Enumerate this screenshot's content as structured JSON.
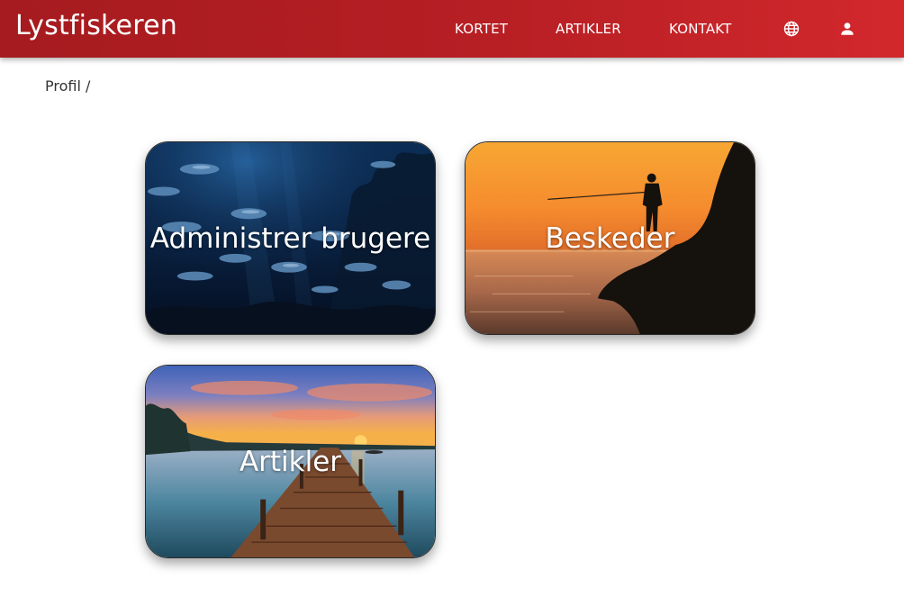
{
  "header": {
    "brand": "Lystfiskeren",
    "nav": [
      {
        "label": "KORTET"
      },
      {
        "label": "ARTIKLER"
      },
      {
        "label": "KONTAKT"
      }
    ],
    "icons": [
      "globe-icon",
      "account-icon"
    ],
    "colors": {
      "bar_start": "#a51b1f",
      "bar_end": "#d2282c"
    }
  },
  "breadcrumb": {
    "text": "Profil /"
  },
  "cards": [
    {
      "label": "Administrer brugere",
      "image": "underwater-fish-school"
    },
    {
      "label": "Beskeder",
      "image": "fisherman-sunset-cliff"
    },
    {
      "label": "Artikler",
      "image": "pier-sunset-lake"
    }
  ]
}
